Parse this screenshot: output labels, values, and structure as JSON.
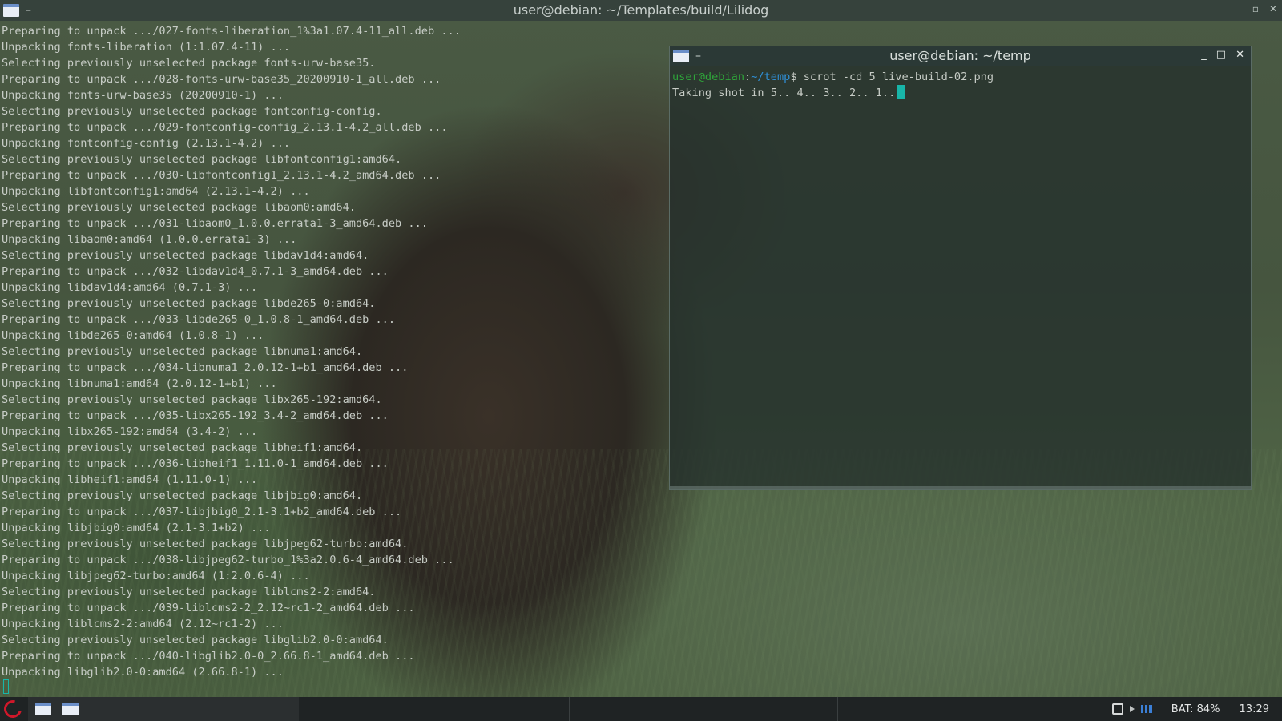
{
  "main_window": {
    "title": "user@debian: ~/Templates/build/Lilidog",
    "menu_glyph": "–",
    "controls": [
      "_",
      "▫",
      "✕"
    ],
    "lines": [
      "Preparing to unpack .../027-fonts-liberation_1%3a1.07.4-11_all.deb ...",
      "Unpacking fonts-liberation (1:1.07.4-11) ...",
      "Selecting previously unselected package fonts-urw-base35.",
      "Preparing to unpack .../028-fonts-urw-base35_20200910-1_all.deb ...",
      "Unpacking fonts-urw-base35 (20200910-1) ...",
      "Selecting previously unselected package fontconfig-config.",
      "Preparing to unpack .../029-fontconfig-config_2.13.1-4.2_all.deb ...",
      "Unpacking fontconfig-config (2.13.1-4.2) ...",
      "Selecting previously unselected package libfontconfig1:amd64.",
      "Preparing to unpack .../030-libfontconfig1_2.13.1-4.2_amd64.deb ...",
      "Unpacking libfontconfig1:amd64 (2.13.1-4.2) ...",
      "Selecting previously unselected package libaom0:amd64.",
      "Preparing to unpack .../031-libaom0_1.0.0.errata1-3_amd64.deb ...",
      "Unpacking libaom0:amd64 (1.0.0.errata1-3) ...",
      "Selecting previously unselected package libdav1d4:amd64.",
      "Preparing to unpack .../032-libdav1d4_0.7.1-3_amd64.deb ...",
      "Unpacking libdav1d4:amd64 (0.7.1-3) ...",
      "Selecting previously unselected package libde265-0:amd64.",
      "Preparing to unpack .../033-libde265-0_1.0.8-1_amd64.deb ...",
      "Unpacking libde265-0:amd64 (1.0.8-1) ...",
      "Selecting previously unselected package libnuma1:amd64.",
      "Preparing to unpack .../034-libnuma1_2.0.12-1+b1_amd64.deb ...",
      "Unpacking libnuma1:amd64 (2.0.12-1+b1) ...",
      "Selecting previously unselected package libx265-192:amd64.",
      "Preparing to unpack .../035-libx265-192_3.4-2_amd64.deb ...",
      "Unpacking libx265-192:amd64 (3.4-2) ...",
      "Selecting previously unselected package libheif1:amd64.",
      "Preparing to unpack .../036-libheif1_1.11.0-1_amd64.deb ...",
      "Unpacking libheif1:amd64 (1.11.0-1) ...",
      "Selecting previously unselected package libjbig0:amd64.",
      "Preparing to unpack .../037-libjbig0_2.1-3.1+b2_amd64.deb ...",
      "Unpacking libjbig0:amd64 (2.1-3.1+b2) ...",
      "Selecting previously unselected package libjpeg62-turbo:amd64.",
      "Preparing to unpack .../038-libjpeg62-turbo_1%3a2.0.6-4_amd64.deb ...",
      "Unpacking libjpeg62-turbo:amd64 (1:2.0.6-4) ...",
      "Selecting previously unselected package liblcms2-2:amd64.",
      "Preparing to unpack .../039-liblcms2-2_2.12~rc1-2_amd64.deb ...",
      "Unpacking liblcms2-2:amd64 (2.12~rc1-2) ...",
      "Selecting previously unselected package libglib2.0-0:amd64.",
      "Preparing to unpack .../040-libglib2.0-0_2.66.8-1_amd64.deb ...",
      "Unpacking libglib2.0-0:amd64 (2.66.8-1) ..."
    ]
  },
  "second_window": {
    "title": "user@debian: ~/temp",
    "menu_glyph": "–",
    "controls": [
      "_",
      "□",
      "✕"
    ],
    "prompt_user": "user@debian",
    "prompt_sep": ":",
    "prompt_path": "~/temp",
    "prompt_symbol": "$",
    "command": " scrot -cd 5 live-build-02.png",
    "output": "Taking shot in 5.. 4.. 3.. 2.. 1.."
  },
  "taskbar": {
    "battery": "BAT: 84%",
    "clock": "13:29"
  },
  "colors": {
    "prompt_user": "#2fa53a",
    "prompt_path": "#2f8fd6",
    "cursor": "#18b5a8",
    "debian_red": "#d0182a"
  },
  "icons": [
    "window-menu-icon",
    "debian-logo-icon",
    "package-update-icon",
    "volume-icon",
    "network-signal-icon"
  ]
}
